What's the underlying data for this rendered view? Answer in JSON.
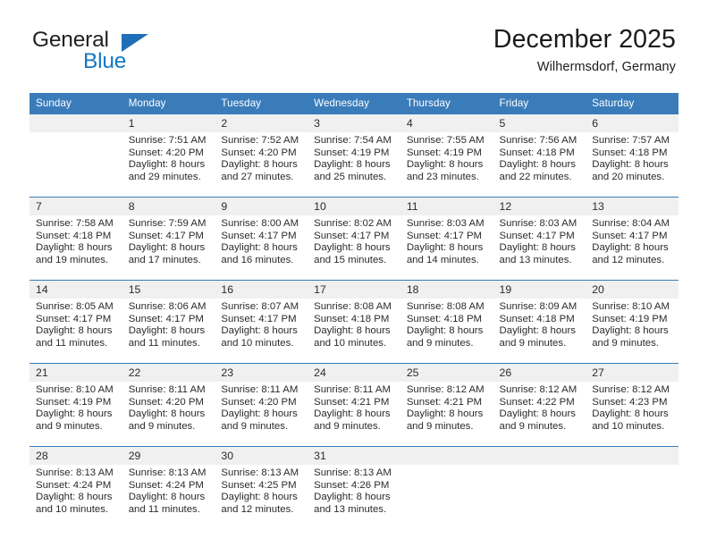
{
  "brand": {
    "name_top": "General",
    "name_bottom": "Blue",
    "accent_color": "#1278c4",
    "triangle_color": "#1e6fb8"
  },
  "header": {
    "title": "December 2025",
    "location": "Wilhermsdorf, Germany"
  },
  "calendar": {
    "header_bg": "#3a7cba",
    "daynum_bg": "#f0f0f0",
    "weekdays": [
      "Sunday",
      "Monday",
      "Tuesday",
      "Wednesday",
      "Thursday",
      "Friday",
      "Saturday"
    ],
    "weeks": [
      [
        {
          "day": "",
          "sunrise": "",
          "sunset": "",
          "daylight1": "",
          "daylight2": ""
        },
        {
          "day": "1",
          "sunrise": "Sunrise: 7:51 AM",
          "sunset": "Sunset: 4:20 PM",
          "daylight1": "Daylight: 8 hours",
          "daylight2": "and 29 minutes."
        },
        {
          "day": "2",
          "sunrise": "Sunrise: 7:52 AM",
          "sunset": "Sunset: 4:20 PM",
          "daylight1": "Daylight: 8 hours",
          "daylight2": "and 27 minutes."
        },
        {
          "day": "3",
          "sunrise": "Sunrise: 7:54 AM",
          "sunset": "Sunset: 4:19 PM",
          "daylight1": "Daylight: 8 hours",
          "daylight2": "and 25 minutes."
        },
        {
          "day": "4",
          "sunrise": "Sunrise: 7:55 AM",
          "sunset": "Sunset: 4:19 PM",
          "daylight1": "Daylight: 8 hours",
          "daylight2": "and 23 minutes."
        },
        {
          "day": "5",
          "sunrise": "Sunrise: 7:56 AM",
          "sunset": "Sunset: 4:18 PM",
          "daylight1": "Daylight: 8 hours",
          "daylight2": "and 22 minutes."
        },
        {
          "day": "6",
          "sunrise": "Sunrise: 7:57 AM",
          "sunset": "Sunset: 4:18 PM",
          "daylight1": "Daylight: 8 hours",
          "daylight2": "and 20 minutes."
        }
      ],
      [
        {
          "day": "7",
          "sunrise": "Sunrise: 7:58 AM",
          "sunset": "Sunset: 4:18 PM",
          "daylight1": "Daylight: 8 hours",
          "daylight2": "and 19 minutes."
        },
        {
          "day": "8",
          "sunrise": "Sunrise: 7:59 AM",
          "sunset": "Sunset: 4:17 PM",
          "daylight1": "Daylight: 8 hours",
          "daylight2": "and 17 minutes."
        },
        {
          "day": "9",
          "sunrise": "Sunrise: 8:00 AM",
          "sunset": "Sunset: 4:17 PM",
          "daylight1": "Daylight: 8 hours",
          "daylight2": "and 16 minutes."
        },
        {
          "day": "10",
          "sunrise": "Sunrise: 8:02 AM",
          "sunset": "Sunset: 4:17 PM",
          "daylight1": "Daylight: 8 hours",
          "daylight2": "and 15 minutes."
        },
        {
          "day": "11",
          "sunrise": "Sunrise: 8:03 AM",
          "sunset": "Sunset: 4:17 PM",
          "daylight1": "Daylight: 8 hours",
          "daylight2": "and 14 minutes."
        },
        {
          "day": "12",
          "sunrise": "Sunrise: 8:03 AM",
          "sunset": "Sunset: 4:17 PM",
          "daylight1": "Daylight: 8 hours",
          "daylight2": "and 13 minutes."
        },
        {
          "day": "13",
          "sunrise": "Sunrise: 8:04 AM",
          "sunset": "Sunset: 4:17 PM",
          "daylight1": "Daylight: 8 hours",
          "daylight2": "and 12 minutes."
        }
      ],
      [
        {
          "day": "14",
          "sunrise": "Sunrise: 8:05 AM",
          "sunset": "Sunset: 4:17 PM",
          "daylight1": "Daylight: 8 hours",
          "daylight2": "and 11 minutes."
        },
        {
          "day": "15",
          "sunrise": "Sunrise: 8:06 AM",
          "sunset": "Sunset: 4:17 PM",
          "daylight1": "Daylight: 8 hours",
          "daylight2": "and 11 minutes."
        },
        {
          "day": "16",
          "sunrise": "Sunrise: 8:07 AM",
          "sunset": "Sunset: 4:17 PM",
          "daylight1": "Daylight: 8 hours",
          "daylight2": "and 10 minutes."
        },
        {
          "day": "17",
          "sunrise": "Sunrise: 8:08 AM",
          "sunset": "Sunset: 4:18 PM",
          "daylight1": "Daylight: 8 hours",
          "daylight2": "and 10 minutes."
        },
        {
          "day": "18",
          "sunrise": "Sunrise: 8:08 AM",
          "sunset": "Sunset: 4:18 PM",
          "daylight1": "Daylight: 8 hours",
          "daylight2": "and 9 minutes."
        },
        {
          "day": "19",
          "sunrise": "Sunrise: 8:09 AM",
          "sunset": "Sunset: 4:18 PM",
          "daylight1": "Daylight: 8 hours",
          "daylight2": "and 9 minutes."
        },
        {
          "day": "20",
          "sunrise": "Sunrise: 8:10 AM",
          "sunset": "Sunset: 4:19 PM",
          "daylight1": "Daylight: 8 hours",
          "daylight2": "and 9 minutes."
        }
      ],
      [
        {
          "day": "21",
          "sunrise": "Sunrise: 8:10 AM",
          "sunset": "Sunset: 4:19 PM",
          "daylight1": "Daylight: 8 hours",
          "daylight2": "and 9 minutes."
        },
        {
          "day": "22",
          "sunrise": "Sunrise: 8:11 AM",
          "sunset": "Sunset: 4:20 PM",
          "daylight1": "Daylight: 8 hours",
          "daylight2": "and 9 minutes."
        },
        {
          "day": "23",
          "sunrise": "Sunrise: 8:11 AM",
          "sunset": "Sunset: 4:20 PM",
          "daylight1": "Daylight: 8 hours",
          "daylight2": "and 9 minutes."
        },
        {
          "day": "24",
          "sunrise": "Sunrise: 8:11 AM",
          "sunset": "Sunset: 4:21 PM",
          "daylight1": "Daylight: 8 hours",
          "daylight2": "and 9 minutes."
        },
        {
          "day": "25",
          "sunrise": "Sunrise: 8:12 AM",
          "sunset": "Sunset: 4:21 PM",
          "daylight1": "Daylight: 8 hours",
          "daylight2": "and 9 minutes."
        },
        {
          "day": "26",
          "sunrise": "Sunrise: 8:12 AM",
          "sunset": "Sunset: 4:22 PM",
          "daylight1": "Daylight: 8 hours",
          "daylight2": "and 9 minutes."
        },
        {
          "day": "27",
          "sunrise": "Sunrise: 8:12 AM",
          "sunset": "Sunset: 4:23 PM",
          "daylight1": "Daylight: 8 hours",
          "daylight2": "and 10 minutes."
        }
      ],
      [
        {
          "day": "28",
          "sunrise": "Sunrise: 8:13 AM",
          "sunset": "Sunset: 4:24 PM",
          "daylight1": "Daylight: 8 hours",
          "daylight2": "and 10 minutes."
        },
        {
          "day": "29",
          "sunrise": "Sunrise: 8:13 AM",
          "sunset": "Sunset: 4:24 PM",
          "daylight1": "Daylight: 8 hours",
          "daylight2": "and 11 minutes."
        },
        {
          "day": "30",
          "sunrise": "Sunrise: 8:13 AM",
          "sunset": "Sunset: 4:25 PM",
          "daylight1": "Daylight: 8 hours",
          "daylight2": "and 12 minutes."
        },
        {
          "day": "31",
          "sunrise": "Sunrise: 8:13 AM",
          "sunset": "Sunset: 4:26 PM",
          "daylight1": "Daylight: 8 hours",
          "daylight2": "and 13 minutes."
        },
        {
          "day": "",
          "sunrise": "",
          "sunset": "",
          "daylight1": "",
          "daylight2": ""
        },
        {
          "day": "",
          "sunrise": "",
          "sunset": "",
          "daylight1": "",
          "daylight2": ""
        },
        {
          "day": "",
          "sunrise": "",
          "sunset": "",
          "daylight1": "",
          "daylight2": ""
        }
      ]
    ]
  }
}
